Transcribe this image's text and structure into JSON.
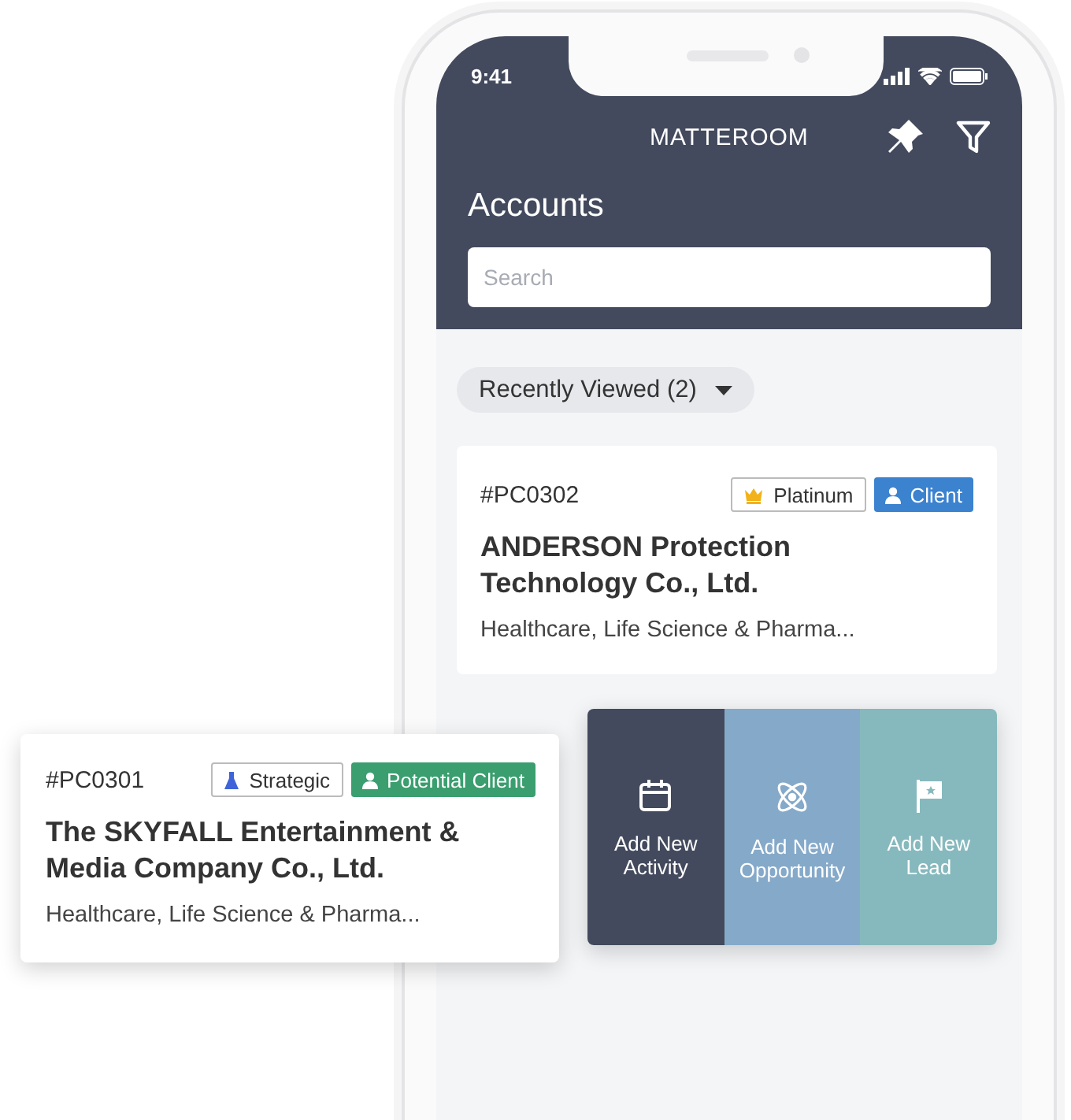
{
  "status_bar": {
    "time": "9:41"
  },
  "header": {
    "app_name": "MATTEROOM",
    "title": "Accounts",
    "search": {
      "placeholder": "Search"
    }
  },
  "filter": {
    "label": "Recently Viewed (2)"
  },
  "accounts": [
    {
      "code": "#PC0302",
      "name": "ANDERSON Protection Technology Co., Ltd.",
      "industry": "Healthcare, Life Science & Pharma...",
      "swiped": false,
      "tags": [
        {
          "label": "Platinum",
          "kind": "platinum"
        },
        {
          "label": "Client",
          "kind": "status",
          "color": "#3b82cf"
        }
      ]
    },
    {
      "code": "#PC0301",
      "name": "The SKYFALL Entertainment & Media Company  Co., Ltd.",
      "industry": "Healthcare, Life Science & Pharma...",
      "swiped": true,
      "tags": [
        {
          "label": "Strategic",
          "kind": "strategic"
        },
        {
          "label": "Potential Client",
          "kind": "status",
          "color": "#3a9e6f"
        }
      ]
    }
  ],
  "swipe_actions": [
    {
      "label": "Add New Activity",
      "kind": "activity",
      "color": "#434a5d"
    },
    {
      "label": "Add New Opportunity",
      "kind": "opportunity",
      "color": "#85a9c9"
    },
    {
      "label": "Add New Lead",
      "kind": "lead",
      "color": "#86b9bd"
    }
  ]
}
